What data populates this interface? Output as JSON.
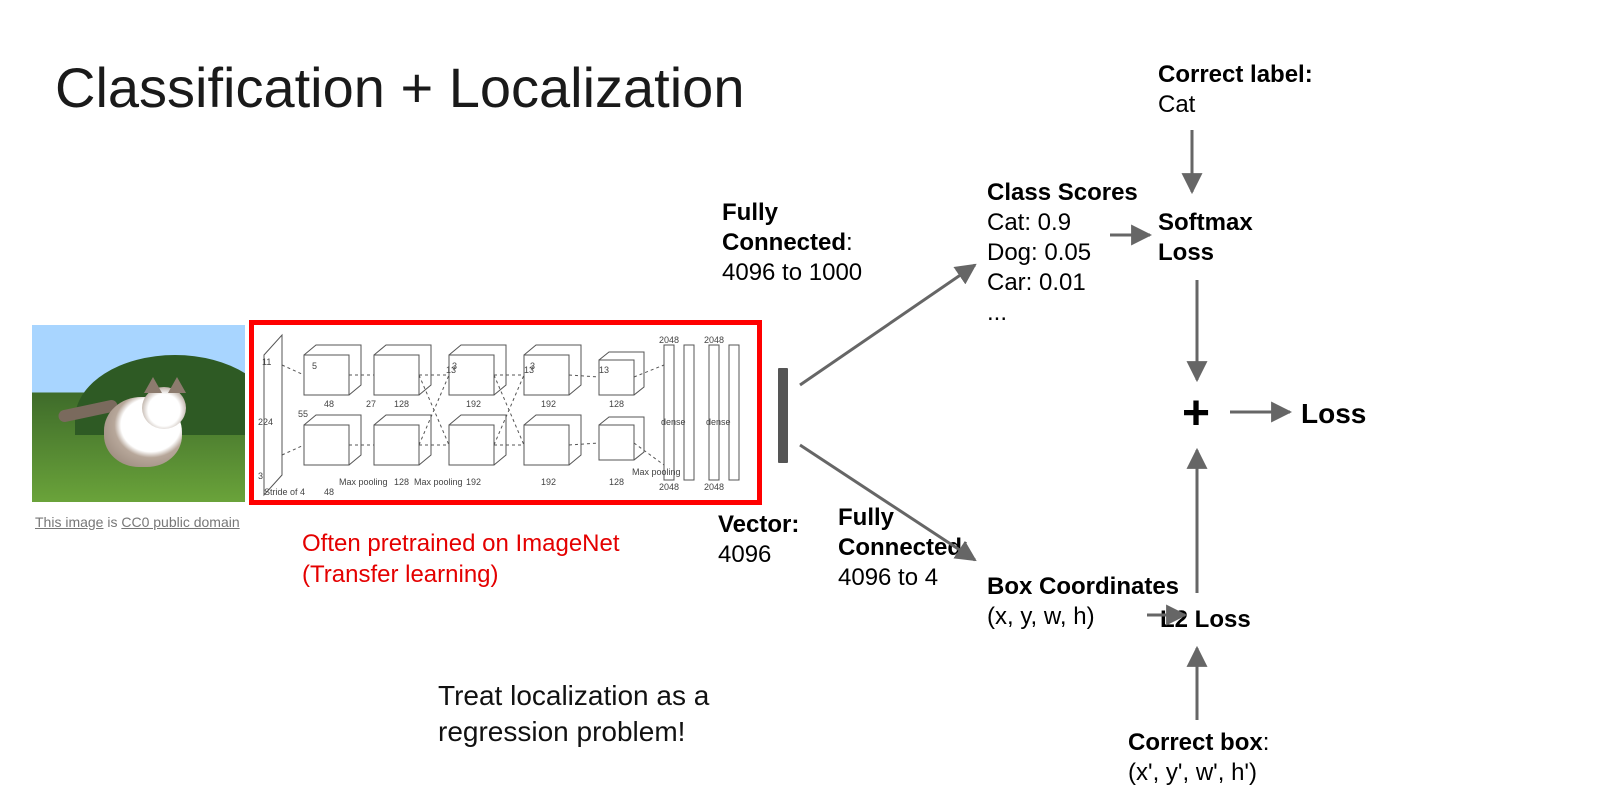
{
  "title": "Classification + Localization",
  "image_caption_prefix": "This image",
  "image_caption_mid": " is ",
  "image_caption_link": "CC0 public domain",
  "cnn_note_line1": "Often pretrained on ImageNet",
  "cnn_note_line2": "(Transfer learning)",
  "vector_label_bold": "Vector:",
  "vector_label_val": "4096",
  "fc_top_bold": "Fully Connected",
  "fc_top_val": "4096 to 1000",
  "fc_bot_bold": "Fully Connected",
  "fc_bot_val": "4096 to 4",
  "class_scores_title": "Class Scores",
  "class_scores_lines": "Cat: 0.9\nDog: 0.05\nCar: 0.01\n...",
  "box_title": "Box Coordinates",
  "box_val": "(x, y, w, h)",
  "softmax": "Softmax Loss",
  "l2loss": "L2 Loss",
  "correct_label_title": "Correct label:",
  "correct_label_val": "Cat",
  "correct_box_title": "Correct box",
  "correct_box_val": "(x', y', w', h')",
  "plus": "+",
  "loss": "Loss",
  "regression_line1": "Treat localization as a",
  "regression_line2": "regression problem!",
  "cnn_internal": {
    "stride": "Stride of 4",
    "maxpool": "Max pooling",
    "dense": "dense",
    "dims": {
      "d224": "224",
      "d55": "55",
      "d48": "48",
      "d27": "27",
      "d128": "128",
      "d192": "192",
      "d13": "13",
      "d2048": "2048",
      "d3": "3",
      "d5": "5",
      "d11": "11"
    }
  }
}
